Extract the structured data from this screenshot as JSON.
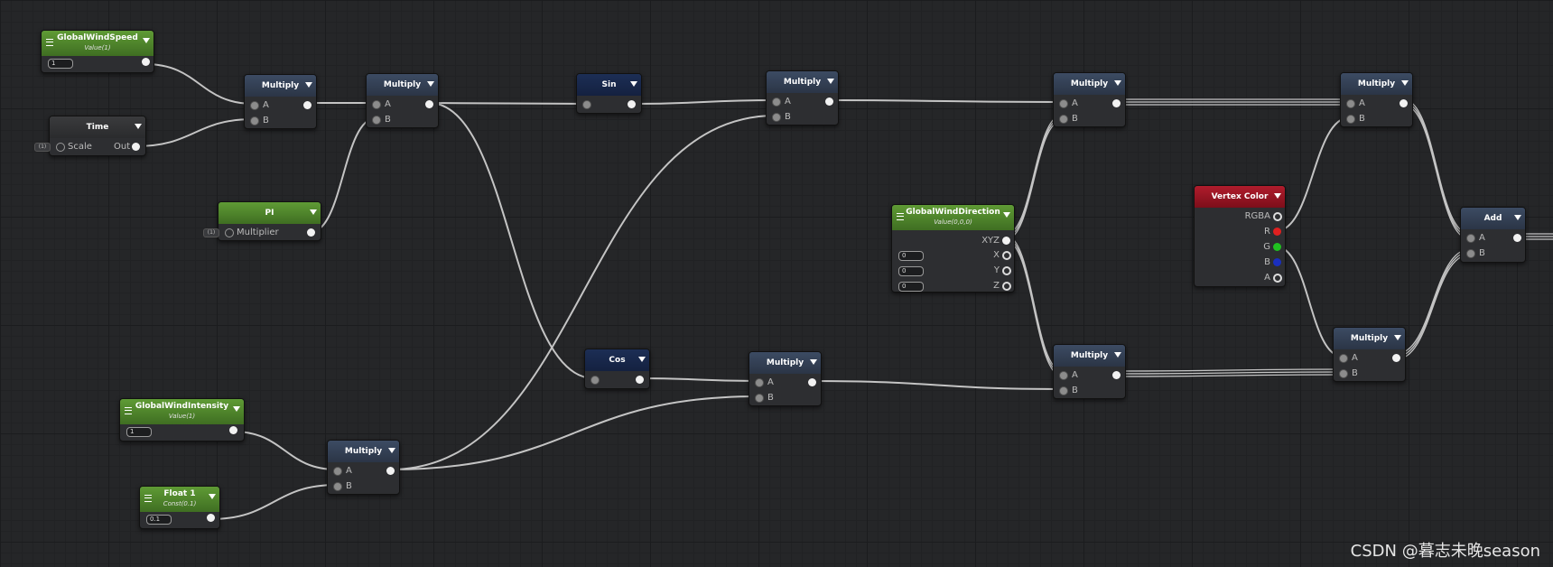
{
  "nodes": {
    "global_wind_speed": {
      "title": "GlobalWindSpeed",
      "subtitle": "Value(1)",
      "field": "1"
    },
    "time": {
      "title": "Time",
      "input_label": "Scale",
      "output_label": "Out",
      "tag": "(1)"
    },
    "pi": {
      "title": "PI",
      "input_label": "Multiplier",
      "tag": "(1)"
    },
    "global_wind_intensity": {
      "title": "GlobalWindIntensity",
      "subtitle": "Value(1)",
      "field": "1"
    },
    "float1": {
      "title": "Float 1",
      "subtitle": "Const(0.1)",
      "field": "0.1"
    },
    "multiply_1": {
      "title": "Multiply",
      "in_a": "A",
      "in_b": "B"
    },
    "multiply_2": {
      "title": "Multiply",
      "in_a": "A",
      "in_b": "B"
    },
    "multiply_3": {
      "title": "Multiply",
      "in_a": "A",
      "in_b": "B"
    },
    "multiply_4": {
      "title": "Multiply",
      "in_a": "A",
      "in_b": "B"
    },
    "multiply_5": {
      "title": "Multiply",
      "in_a": "A",
      "in_b": "B"
    },
    "multiply_6": {
      "title": "Multiply",
      "in_a": "A",
      "in_b": "B"
    },
    "multiply_7": {
      "title": "Multiply",
      "in_a": "A",
      "in_b": "B"
    },
    "multiply_8": {
      "title": "Multiply",
      "in_a": "A",
      "in_b": "B"
    },
    "multiply_9": {
      "title": "Multiply",
      "in_a": "A",
      "in_b": "B"
    },
    "sin": {
      "title": "Sin"
    },
    "cos": {
      "title": "Cos"
    },
    "global_wind_direction": {
      "title": "GlobalWindDirection",
      "subtitle": "Value(0,0,0)",
      "out_xyz": "XYZ",
      "out_x": "X",
      "out_y": "Y",
      "out_z": "Z",
      "field_x": "0",
      "field_y": "0",
      "field_z": "0"
    },
    "vertex_color": {
      "title": "Vertex Color",
      "out_rgba": "RGBA",
      "out_r": "R",
      "out_g": "G",
      "out_b": "B",
      "out_a": "A"
    },
    "add": {
      "title": "Add",
      "in_a": "A",
      "in_b": "B"
    }
  },
  "colors": {
    "port_r": "#e02020",
    "port_g": "#20c020",
    "port_b": "#1a2fbf",
    "wire": "#c4c4c4"
  },
  "watermark": "CSDN @暮志未晚season"
}
